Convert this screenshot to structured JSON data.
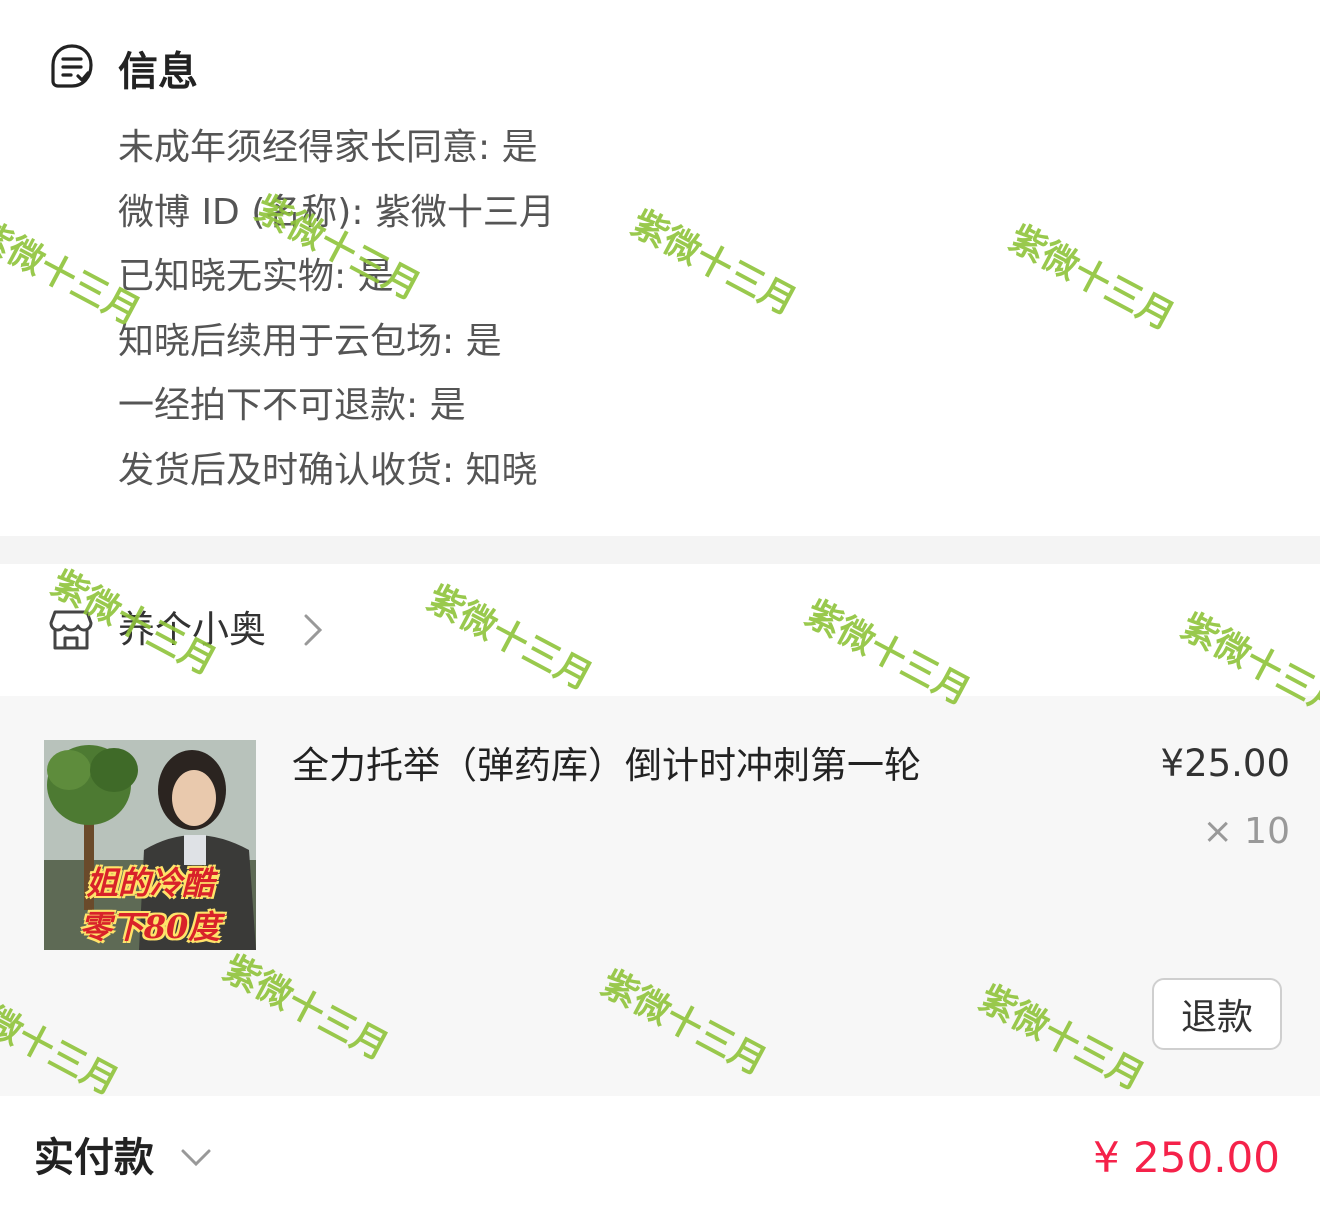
{
  "info": {
    "title": "信息",
    "lines": [
      "未成年须经得家长同意: 是",
      "微博 ID (名称): 紫微十三月",
      "已知晓无实物: 是",
      "知晓后续用于云包场: 是",
      "一经拍下不可退款: 是",
      "发货后及时确认收货: 知晓"
    ]
  },
  "shop": {
    "name": "养个小奥",
    "icon": "shop-icon"
  },
  "item": {
    "title": "全力托举（弹药库）倒计时冲刺第一轮",
    "price": "¥25.00",
    "quantity": "× 10",
    "thumb_caption_line1": "姐的冷酷",
    "thumb_caption_line2": "零下80度",
    "refund_label": "退款"
  },
  "total": {
    "label": "实付款",
    "amount": "¥ 250.00"
  },
  "watermark": {
    "text": "紫微十三月",
    "color": "#8fc43a"
  },
  "colors": {
    "accent": "#f5224a",
    "card_bg": "#f7f7f7"
  }
}
